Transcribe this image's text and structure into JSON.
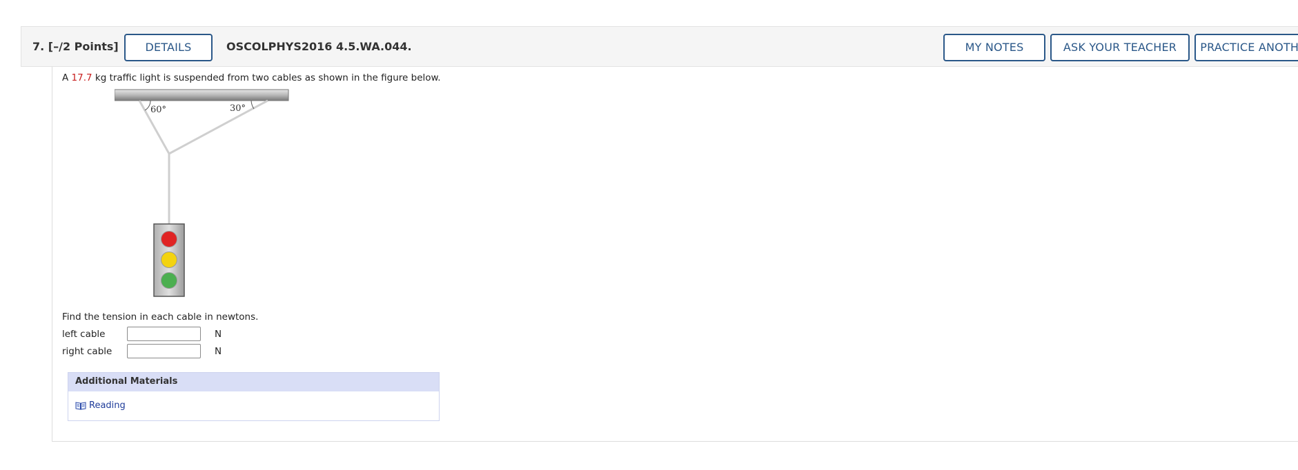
{
  "question": {
    "number_points": "7.  [–/2 Points]",
    "details_label": "DETAILS",
    "code": "OSCOLPHYS2016 4.5.WA.044.",
    "my_notes_label": "MY NOTES",
    "ask_teacher_label": "ASK YOUR TEACHER",
    "practice_label": "PRACTICE ANOTHER"
  },
  "prompt": {
    "prefix": "A ",
    "mass": "17.7",
    "suffix": " kg traffic light is suspended from two cables as shown in the figure below."
  },
  "figure": {
    "left_angle": "60°",
    "right_angle": "30°",
    "colors": {
      "red": "#e02424",
      "yellow": "#f3d30f",
      "green": "#4caf50"
    }
  },
  "find_text": "Find the tension in each cable in newtons.",
  "answers": {
    "left": {
      "label": "left cable",
      "value": "",
      "unit": "N"
    },
    "right": {
      "label": "right cable",
      "value": "",
      "unit": "N"
    }
  },
  "additional": {
    "title": "Additional Materials",
    "reading_label": "Reading",
    "reading_icon": "book-icon"
  }
}
